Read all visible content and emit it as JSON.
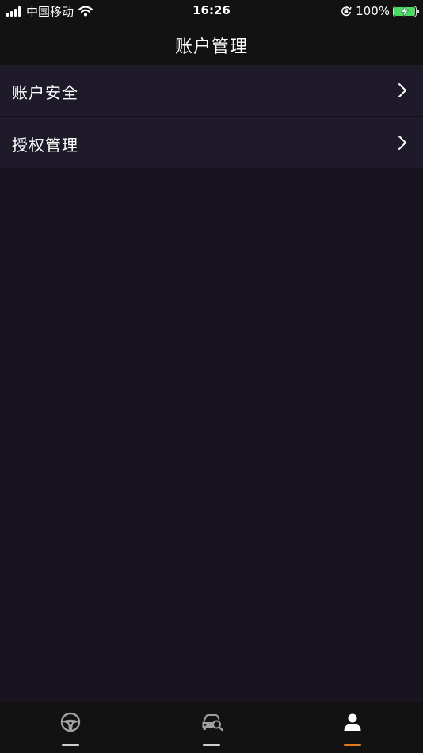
{
  "status_bar": {
    "carrier": "中国移动",
    "time": "16:26",
    "battery": "100%",
    "battery_level": 1.0
  },
  "nav": {
    "title": "账户管理"
  },
  "menu": {
    "items": [
      {
        "label": "账户安全",
        "icon": "chevron-right-icon"
      },
      {
        "label": "授权管理",
        "icon": "chevron-right-icon"
      }
    ]
  },
  "tab_bar": {
    "tabs": [
      {
        "icon": "steering-wheel-icon",
        "active": false
      },
      {
        "icon": "car-search-icon",
        "active": false
      },
      {
        "icon": "user-icon",
        "active": true
      }
    ],
    "active_color": "#e37a1f",
    "inactive_color": "#9a9a9a"
  },
  "colors": {
    "background": "#19131f",
    "bar_background": "#121212",
    "row_background": "#1f1a29",
    "battery_green": "#4cd964"
  }
}
